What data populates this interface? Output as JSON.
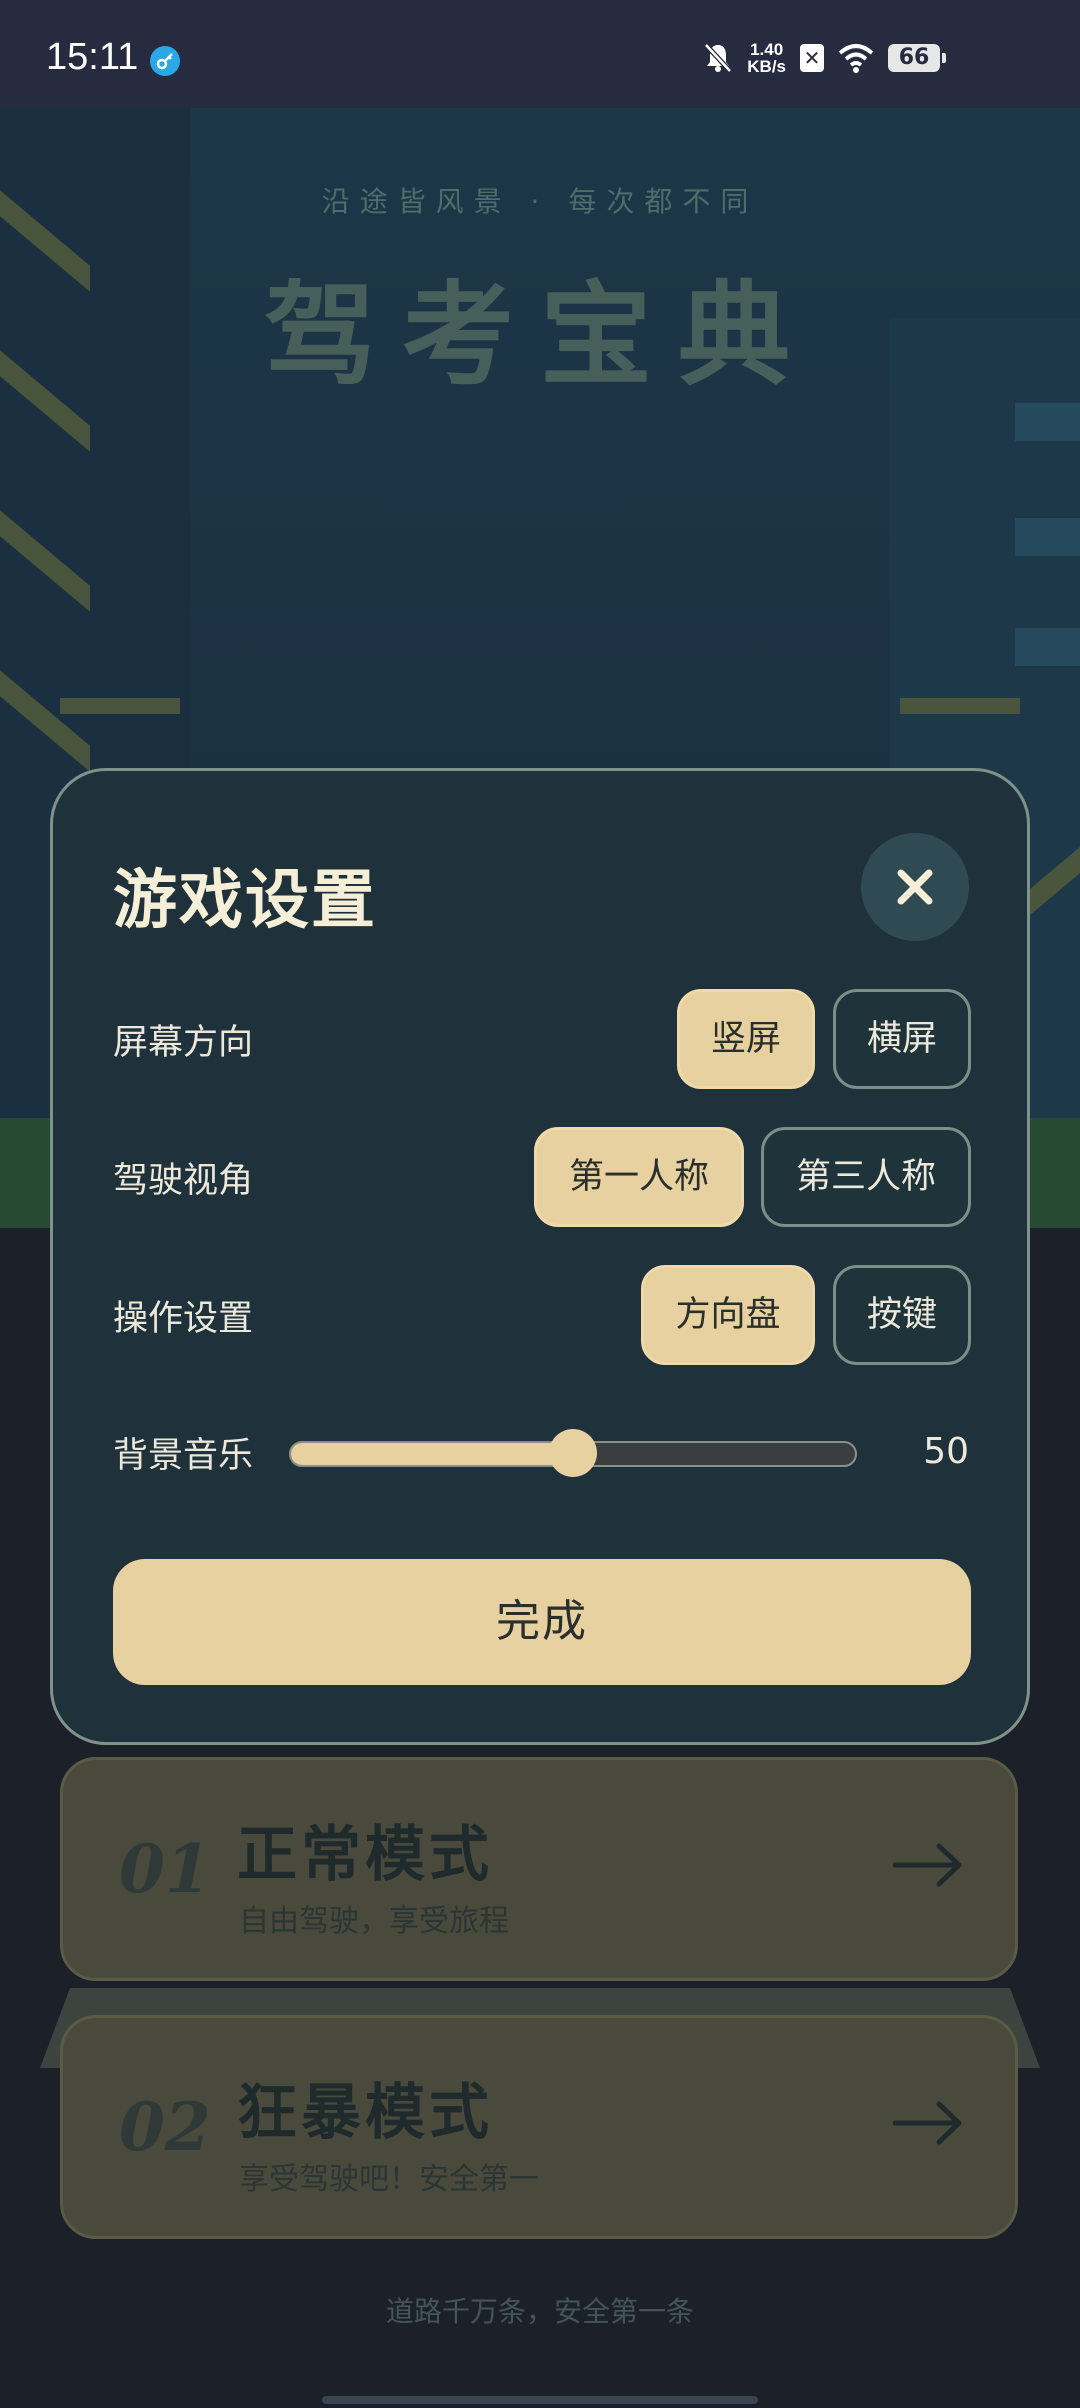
{
  "status_bar": {
    "time": "15:11",
    "net_speed_value": "1.40",
    "net_speed_unit": "KB/s",
    "battery": "66"
  },
  "hero": {
    "tagline": "沿途皆风景 · 每次都不同",
    "title": "驾考宝典"
  },
  "modes": [
    {
      "number": "01",
      "title": "正常模式",
      "subtitle": "自由驾驶，享受旅程"
    },
    {
      "number": "02",
      "title": "狂暴模式",
      "subtitle": "享受驾驶吧！安全第一"
    }
  ],
  "footer": "道路千万条，安全第一条",
  "settings": {
    "title": "游戏设置",
    "orientation": {
      "label": "屏幕方向",
      "options": [
        "竖屏",
        "横屏"
      ],
      "selected": "竖屏"
    },
    "camera": {
      "label": "驾驶视角",
      "options": [
        "第一人称",
        "第三人称"
      ],
      "selected": "第一人称"
    },
    "controls": {
      "label": "操作设置",
      "options": [
        "方向盘",
        "按键"
      ],
      "selected": "方向盘"
    },
    "music": {
      "label": "背景音乐",
      "value": 50,
      "max": 100
    },
    "done_label": "完成"
  },
  "colors": {
    "accent": "#e8d1a1",
    "modal_bg": "#1f313a",
    "status_bar": "#262b40"
  }
}
